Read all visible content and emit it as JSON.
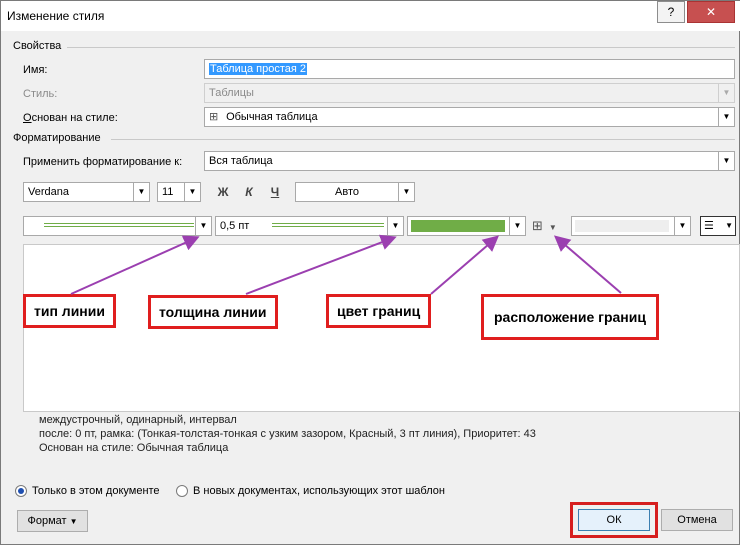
{
  "window": {
    "title": "Изменение стиля",
    "help_label": "?",
    "close_label": "✕"
  },
  "properties": {
    "section_label": "Свойства",
    "name_label": "Имя:",
    "name_value": "Таблица простая 2",
    "style_label": "Стиль:",
    "style_value": "Таблицы",
    "based_label": "Основан на стиле:",
    "based_value": "Обычная таблица"
  },
  "formatting": {
    "section_label": "Форматирование",
    "apply_label": "Применить форматирование к:",
    "apply_value": "Вся таблица",
    "font": "Verdana",
    "size": "11",
    "bold": "Ж",
    "italic": "К",
    "underline": "Ч",
    "color": "Авто"
  },
  "borders": {
    "weight": "0,5 пт",
    "color_hex": "#70ad47"
  },
  "annotations": {
    "line_type": "тип линии",
    "line_weight": "толщина линии",
    "border_color": "цвет границ",
    "border_position": "расположение границ"
  },
  "description": {
    "line1": "междустрочный,  одинарный, интервал",
    "line2": "после: 0 пт, рамка: (Тонкая-толстая-тонкая с узким зазором, Красный,  3 пт линия), Приоритет: 43",
    "line3": "Основан на стиле: Обычная таблица"
  },
  "scope": {
    "option1": "Только в этом документе",
    "option2": "В новых документах, использующих этот шаблон",
    "selected": "option1"
  },
  "buttons": {
    "format": "Формат",
    "ok": "ОК",
    "cancel": "Отмена"
  },
  "colors": {
    "annotation_red": "#e01e1e",
    "arrow_purple": "#9b3fb0"
  }
}
